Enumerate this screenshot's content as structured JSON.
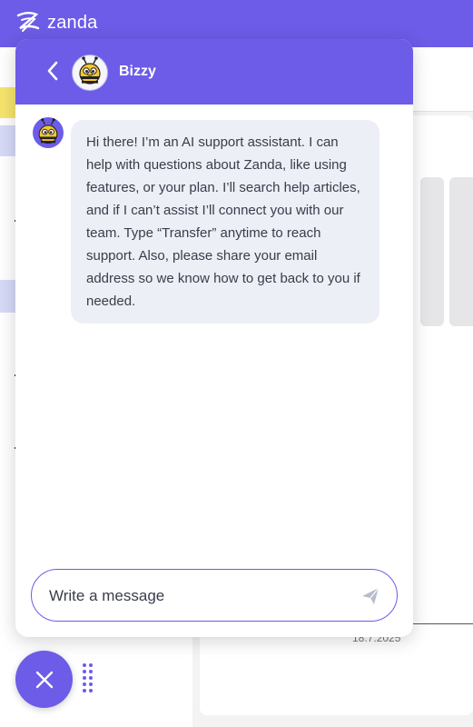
{
  "app": {
    "brand_name": "zanda",
    "date_label": "18.7.2025"
  },
  "chat": {
    "bot_name": "Bizzy",
    "greeting": "Hi there! I’m an AI support assistant. I can help with questions about Zanda, like using features, or your plan. I’ll search help articles, and if I can’t assist I’ll connect you with our team. Type “Transfer” anytime to reach support. Also, please share your email address so we know how to get back to you if needed.",
    "input_placeholder": "Write a message"
  },
  "colors": {
    "accent": "#6c5ce7",
    "bubble_bg": "#eceff6",
    "bee_yellow": "#f7c72e"
  },
  "icons": [
    "zanda-logo-icon",
    "back-chevron-icon",
    "bee-icon",
    "send-icon",
    "close-icon",
    "drag-handle-icon"
  ]
}
